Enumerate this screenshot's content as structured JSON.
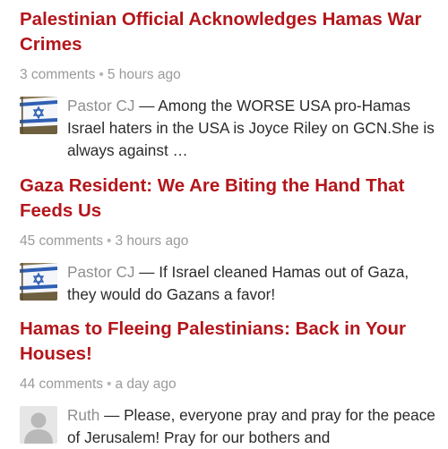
{
  "articles": [
    {
      "title": "Palestinian Official Acknowledges Hamas War Crimes",
      "comments": "3 comments",
      "separator": "•",
      "time": "5 hours ago",
      "latest_comment": {
        "author": "Pastor CJ",
        "dash": " — ",
        "text": "Among the WORSE USA pro-Hamas Israel haters in the USA is Joyce Riley on GCN.She is always against …",
        "avatar": "israel-flag-avatar-icon"
      }
    },
    {
      "title": "Gaza Resident: We Are Biting the Hand That Feeds Us",
      "comments": "45 comments",
      "separator": "•",
      "time": "3 hours ago",
      "latest_comment": {
        "author": "Pastor CJ",
        "dash": " — ",
        "text": "If Israel cleaned Hamas out of Gaza, they would do Gazans a favor!",
        "avatar": "israel-flag-avatar-icon"
      }
    },
    {
      "title": "Hamas to Fleeing Palestinians: Back in Your Houses!",
      "comments": "44 comments",
      "separator": "•",
      "time": "a day ago",
      "latest_comment": {
        "author": "Ruth",
        "dash": " — ",
        "text": "Please, everyone pray and pray for the peace of Jerusalem! Pray for our bothers and",
        "avatar": "default-user-avatar-icon"
      }
    }
  ],
  "colors": {
    "title": "#b3161b",
    "meta": "#9a9a9a",
    "author": "#8f8f8f",
    "body_text": "#2b2b2b",
    "flag_blue": "#2f5fb3"
  }
}
